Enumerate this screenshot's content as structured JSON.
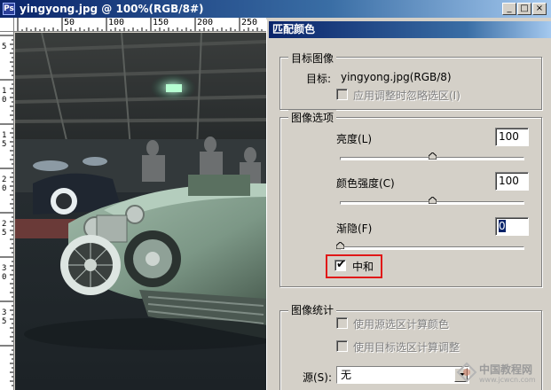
{
  "document": {
    "title": "yingyong.jpg @ 100%(RGB/8#)",
    "app_icon": "Ps",
    "ruler_top_labels": [
      "50",
      "100",
      "150",
      "200",
      "250"
    ],
    "ruler_left_labels": [
      "5",
      "1 0",
      "1 5",
      "2 0",
      "2 5",
      "3 0",
      "3 5"
    ],
    "window_buttons": [
      "_",
      "□",
      "×"
    ]
  },
  "dialog": {
    "title": "匹配颜色",
    "target_image": {
      "group_label": "目标图像",
      "target_label": "目标:",
      "target_value": "yingyong.jpg(RGB/8)",
      "ignore_selection_label": "应用调整时忽略选区(I)",
      "ignore_selection_checked": false,
      "ignore_selection_enabled": false
    },
    "image_options": {
      "group_label": "图像选项",
      "luminance_label": "亮度(L)",
      "luminance_value": "100",
      "luminance_level": 0.5,
      "color_intensity_label": "颜色强度(C)",
      "color_intensity_value": "100",
      "color_intensity_level": 0.5,
      "fade_label": "渐隐(F)",
      "fade_value": "0",
      "fade_level": 0.0,
      "neutralize_label": "中和",
      "neutralize_checked": true
    },
    "image_statistics": {
      "group_label": "图像统计",
      "use_source_selection_label": "使用源选区计算颜色",
      "use_target_selection_label": "使用目标选区计算调整",
      "source_label": "源(S):",
      "source_value": "无"
    }
  },
  "watermark": {
    "text": "中国教程网",
    "subtext": "www.jcwcn.com"
  },
  "colors": {
    "title_bar": "#0a246a",
    "dialog_bg": "#d4d0c8",
    "highlight": "#e01818"
  }
}
